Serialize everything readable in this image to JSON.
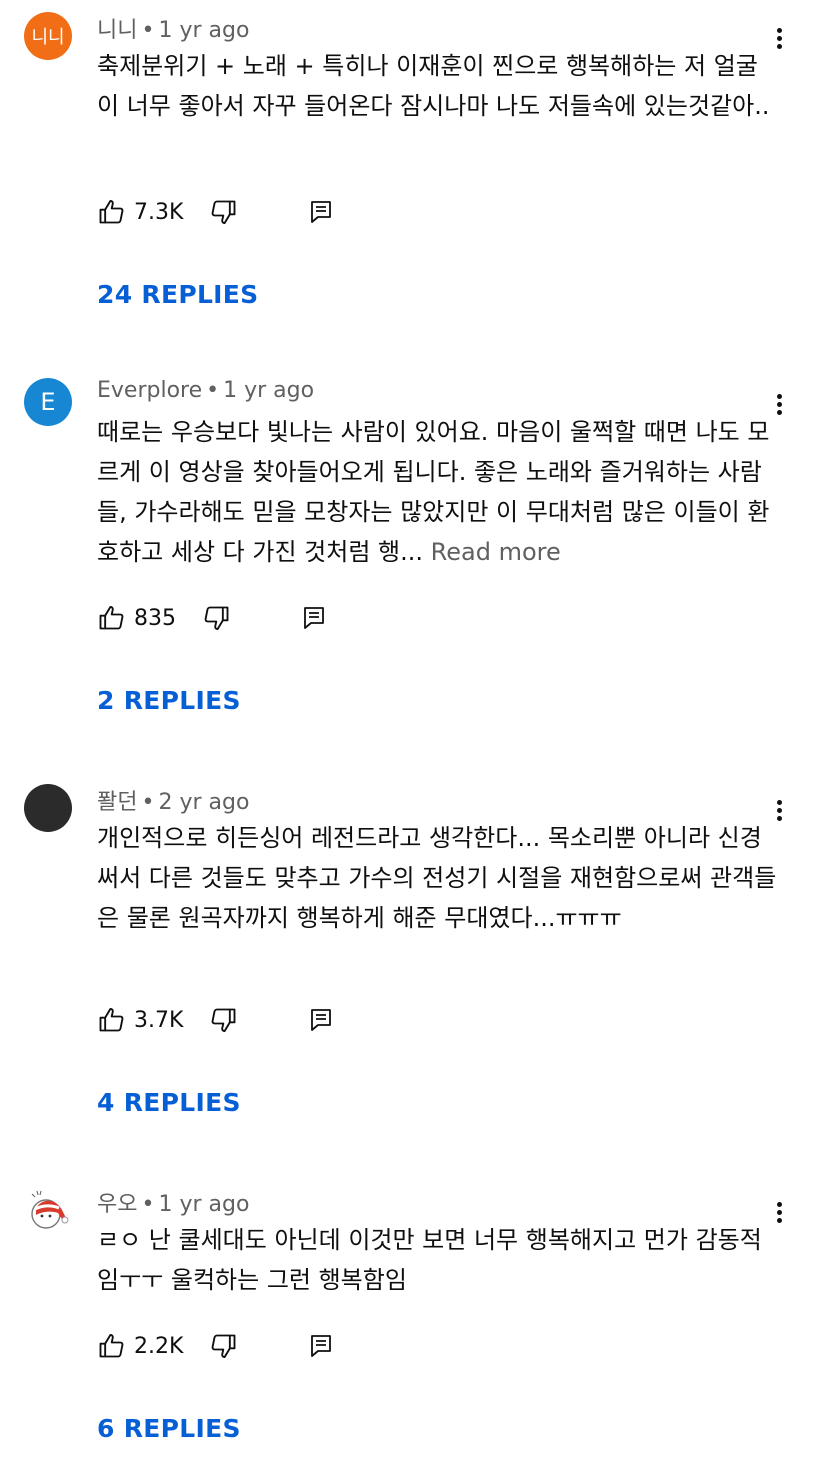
{
  "comments": [
    {
      "author": "니니",
      "time": "1 yr ago",
      "avatar_text": "니니",
      "avatar_color": "#f26e16",
      "text": "축제분위기 + 노래 + 특히나 이재훈이 찐으로 행복해하는 저 얼굴이 너무 좋아서 자꾸 들어온다 잠시나마 나도 저들속에 있는것같아..",
      "read_more": "",
      "likes": "7.3K",
      "replies": "24 REPLIES"
    },
    {
      "author": "Everplore",
      "time": "1 yr ago",
      "avatar_text": "E",
      "avatar_color": "#1787d4",
      "text": "때로는 우승보다 빛나는 사람이 있어요. 마음이 울쩍할 때면 나도 모르게 이 영상을 찾아들어오게 됩니다. 좋은 노래와 즐거워하는 사람들, 가수라해도 믿을 모창자는 많았지만 이 무대처럼 많은 이들이 환호하고 세상 다 가진 것처럼 행...",
      "read_more": "Read more",
      "likes": "835",
      "replies": "2 REPLIES"
    },
    {
      "author": "퐐던",
      "time": "2 yr ago",
      "avatar_text": "",
      "avatar_color": "#2b2b2b",
      "text": "개인적으로 히든싱어 레전드라고 생각한다... 목소리뿐 아니라 신경써서 다른 것들도 맞추고 가수의 전성기 시절을 재현함으로써 관객들은 물론 원곡자까지 행복하게 해준 무대였다...ㅠㅠㅠ",
      "read_more": "",
      "likes": "3.7K",
      "replies": "4 REPLIES"
    },
    {
      "author": "우오",
      "time": "1 yr ago",
      "avatar_text": "",
      "avatar_color": "#ffffff",
      "text": "ㄹㅇ 난 쿨세대도 아닌데 이것만 보면 너무 행복해지고 먼가 감동적임ㅜㅜ 울컥하는 그런 행복함임",
      "read_more": "",
      "likes": "2.2K",
      "replies": "6 REPLIES"
    }
  ],
  "icons": {
    "like": "thumbs-up-icon",
    "dislike": "thumbs-down-icon",
    "reply": "reply-icon",
    "menu": "more-vert-icon"
  },
  "colors": {
    "link": "#065fd4",
    "meta": "#606060",
    "text": "#0f0f0f"
  }
}
